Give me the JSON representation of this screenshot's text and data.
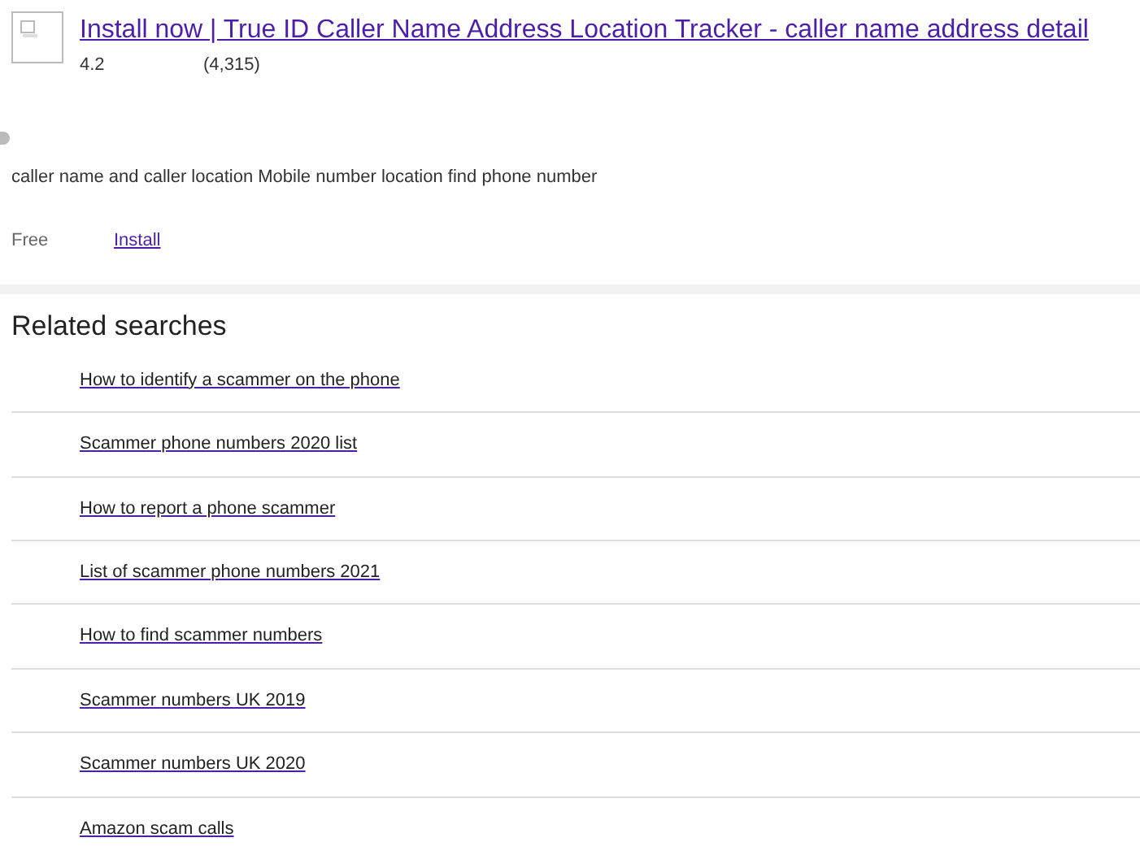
{
  "ad": {
    "title": "Install now | True ID Caller Name Address Location Tracker - caller name address detail",
    "rating": "4.2",
    "reviews": "(4,315)",
    "description": "caller name and caller location Mobile number location find phone number",
    "price": "Free",
    "action": "Install"
  },
  "related": {
    "heading": "Related searches",
    "items": [
      "How to identify a scammer on the phone",
      "Scammer phone numbers 2020 list",
      "How to report a phone scammer",
      "List of scammer phone numbers 2021",
      "How to find scammer numbers",
      "Scammer numbers UK 2019",
      "Scammer numbers UK 2020",
      "Amazon scam calls"
    ]
  }
}
